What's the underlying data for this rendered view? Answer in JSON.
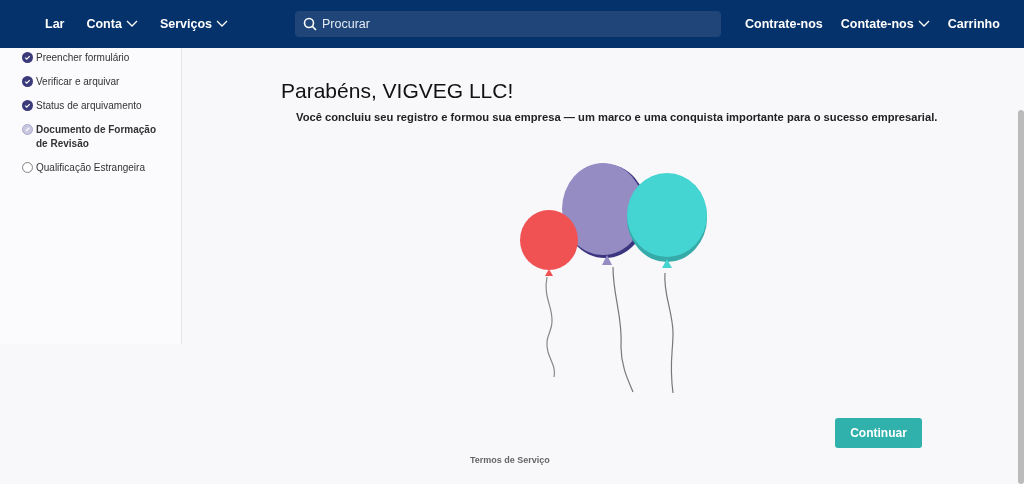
{
  "nav": {
    "left": [
      {
        "label": "Lar",
        "dropdown": false
      },
      {
        "label": "Conta",
        "dropdown": true
      },
      {
        "label": "Serviços",
        "dropdown": true
      }
    ],
    "search": {
      "placeholder": "Procurar"
    },
    "right": [
      {
        "label": "Contrate-nos",
        "dropdown": false
      },
      {
        "label": "Contate-nos",
        "dropdown": true
      },
      {
        "label": "Carrinho",
        "dropdown": false
      }
    ]
  },
  "steps": [
    {
      "label": "Preencher formulário",
      "kind": "done"
    },
    {
      "label": "Verificar e arquivar",
      "kind": "done"
    },
    {
      "label": "Status de arquivamento",
      "kind": "done"
    },
    {
      "label": "Documento de Formação de Revisão",
      "kind": "current"
    },
    {
      "label": "Qualificação Estrangeira",
      "kind": "pending"
    }
  ],
  "main": {
    "title": "Parabéns, VIGVEG LLC!",
    "message": "Você concluiu seu registro e formou sua empresa — um marco e uma conquista importante para o sucesso empresarial.",
    "button": "Continuar"
  },
  "footer": {
    "link": "Termos de Serviço"
  }
}
